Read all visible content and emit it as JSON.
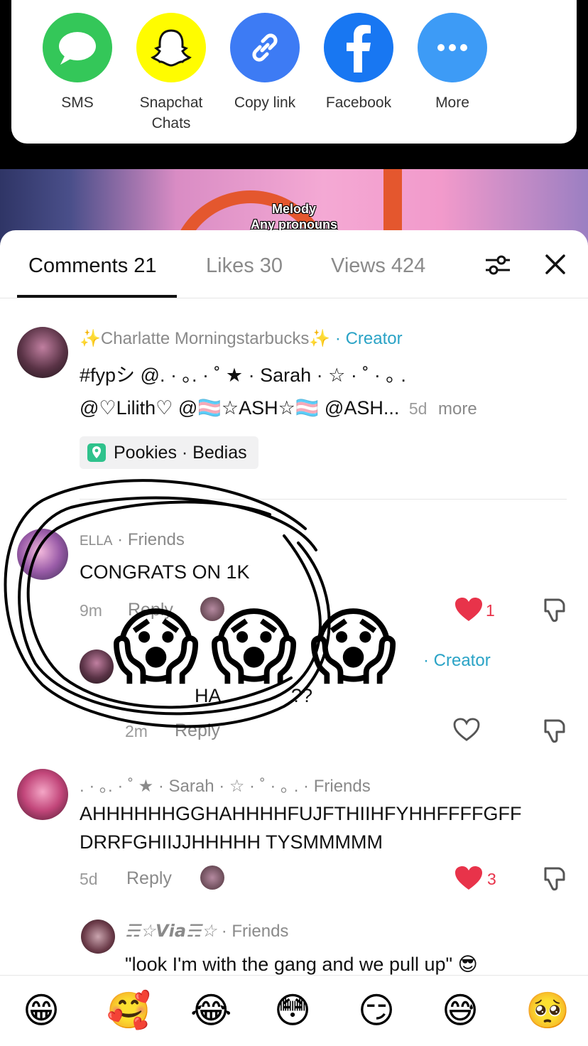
{
  "share": {
    "items": [
      {
        "label": "SMS",
        "icon": "speech-bubble-icon",
        "color": "#34C759"
      },
      {
        "label": "Snapchat\nChats",
        "icon": "snapchat-ghost-icon",
        "color": "#FFFC00"
      },
      {
        "label": "Copy link",
        "icon": "link-icon",
        "color": "#3D7BF4"
      },
      {
        "label": "Facebook",
        "icon": "facebook-icon",
        "color": "#1877F2"
      },
      {
        "label": "More",
        "icon": "more-dots-icon",
        "color": "#3D9BF6"
      }
    ]
  },
  "video": {
    "caption_line1": "Melody",
    "caption_line2": "Any pronouns"
  },
  "tabs": {
    "comments": "Comments 21",
    "likes": "Likes 30",
    "views": "Views 424"
  },
  "comments": [
    {
      "name": "✨Charlatte Morningstarbucks✨",
      "badge": " · Creator",
      "line1": "#fypシ @. · ｡. · ˚  ★ · Sarah · ☆ · ˚    · ｡ .",
      "line2": "@♡Lilith♡ @🏳️‍⚧️☆ASH☆🏳️‍⚧️ @ASH...",
      "time": "5d",
      "more": "more",
      "location": "Pookies · Bedias"
    },
    {
      "name": "ELLA",
      "badge": " · Friends",
      "text": "CONGRATS ON 1K",
      "time": "9m",
      "reply": "Reply",
      "likes": "1"
    },
    {
      "badge": " · Creator",
      "text_fragment_a": "HA",
      "text_fragment_b": "??",
      "time": "2m",
      "reply": "Reply"
    },
    {
      "name": ". · ｡. · ˚  ★ · Sarah · ☆ · ˚    · ｡ .",
      "badge": " · Friends",
      "line1": "AHHHHHHGGHAHHHHFUJFTHIIHFYHHFFFFGFF",
      "line2": "DRRFGHIIJJHHHHH TYSMMMMM",
      "time": "5d",
      "reply": "Reply",
      "likes": "3"
    },
    {
      "name": "☴☆𝙑𝙞𝙖☴☆",
      "badge": " · Friends",
      "text": "\"look I'm with the gang and we pull up\" 😎"
    }
  ],
  "overlay_emoji": "😱",
  "emoji_bar": [
    "😁",
    "🥰",
    "😂",
    "😳",
    "😏",
    "😅",
    "🥺"
  ],
  "colors": {
    "creator": "#2aa3c6",
    "like_red": "#e8334a",
    "muted": "#8a8a8a"
  }
}
